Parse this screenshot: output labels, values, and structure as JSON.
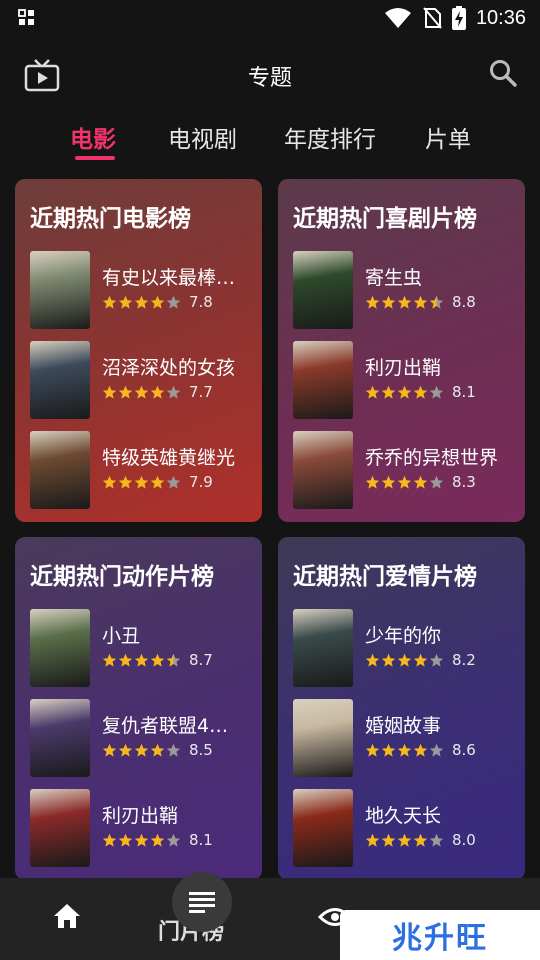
{
  "status": {
    "time": "10:36"
  },
  "header": {
    "title": "专题"
  },
  "tabs": [
    {
      "label": "电影",
      "active": true
    },
    {
      "label": "电视剧",
      "active": false
    },
    {
      "label": "年度排行",
      "active": false
    },
    {
      "label": "片单",
      "active": false
    }
  ],
  "cards": [
    {
      "title": "近期热门电影榜",
      "movies": [
        {
          "name": "有史以来最棒…",
          "rating": 7.8,
          "stars": 4
        },
        {
          "name": "沼泽深处的女孩",
          "rating": 7.7,
          "stars": 4
        },
        {
          "name": "特级英雄黄继光",
          "rating": 7.9,
          "stars": 4
        }
      ]
    },
    {
      "title": "近期热门喜剧片榜",
      "movies": [
        {
          "name": "寄生虫",
          "rating": 8.8,
          "stars": 4.5
        },
        {
          "name": "利刃出鞘",
          "rating": 8.1,
          "stars": 4
        },
        {
          "name": "乔乔的异想世界",
          "rating": 8.3,
          "stars": 4
        }
      ]
    },
    {
      "title": "近期热门动作片榜",
      "movies": [
        {
          "name": "小丑",
          "rating": 8.7,
          "stars": 4.5
        },
        {
          "name": "复仇者联盟4…",
          "rating": 8.5,
          "stars": 4
        },
        {
          "name": "利刃出鞘",
          "rating": 8.1,
          "stars": 4
        }
      ]
    },
    {
      "title": "近期热门爱情片榜",
      "movies": [
        {
          "name": "少年的你",
          "rating": 8.2,
          "stars": 4
        },
        {
          "name": "婚姻故事",
          "rating": 8.6,
          "stars": 4
        },
        {
          "name": "地久天长",
          "rating": 8.0,
          "stars": 4
        }
      ]
    }
  ],
  "bottom_nav": {
    "center_label": "门片榜"
  },
  "watermark": {
    "text": "兆升旺"
  },
  "colors": {
    "accent": "#f0336b",
    "star": "#f6b81c",
    "star_empty": "#9a9a9a"
  }
}
